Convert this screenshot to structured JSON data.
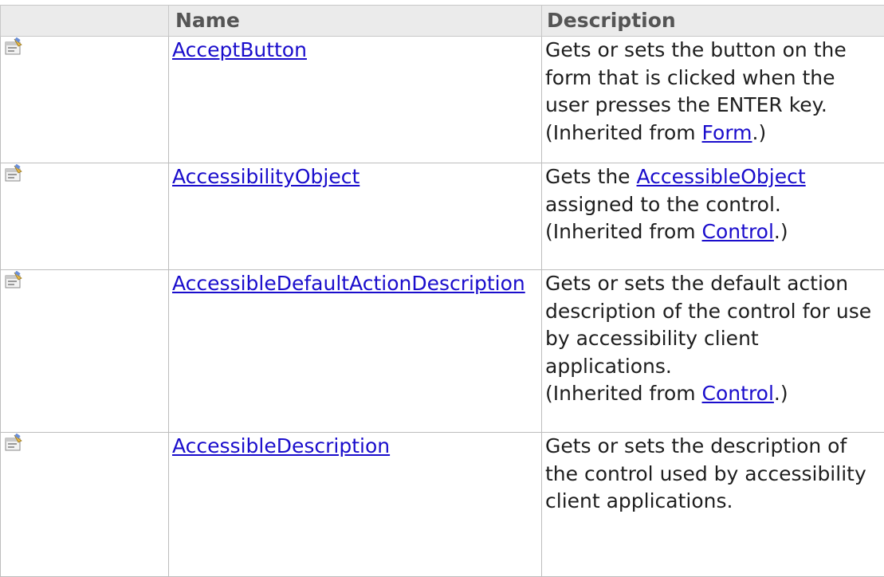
{
  "table": {
    "headers": {
      "icon": "",
      "name": "Name",
      "description": "Description"
    },
    "rows": [
      {
        "icon": "public-property-icon",
        "name": "AcceptButton",
        "description": "Gets or sets the button on the form that is clicked when the user presses the ENTER key.",
        "inherited_prefix": "(Inherited from ",
        "inherited_link": "Form",
        "inherited_suffix": ".)"
      },
      {
        "icon": "public-property-icon",
        "name": "AccessibilityObject",
        "description_pre": "Gets the ",
        "description_link": "AccessibleObject",
        "description_post": " assigned to the control.",
        "inherited_prefix": "(Inherited from ",
        "inherited_link": "Control",
        "inherited_suffix": ".)"
      },
      {
        "icon": "public-property-icon",
        "name": "AccessibleDefaultActionDescription",
        "description": "Gets or sets the default action description of the control for use by accessibility client applications.",
        "inherited_prefix": "(Inherited from ",
        "inherited_link": "Control",
        "inherited_suffix": ".)"
      },
      {
        "icon": "public-property-icon",
        "name": "AccessibleDescription",
        "description": "Gets or sets the description of the control used by accessibility client applications."
      }
    ]
  },
  "colors": {
    "link": "#1a0dcc",
    "header_bg": "#ebebeb",
    "border": "#bdbdbd"
  }
}
